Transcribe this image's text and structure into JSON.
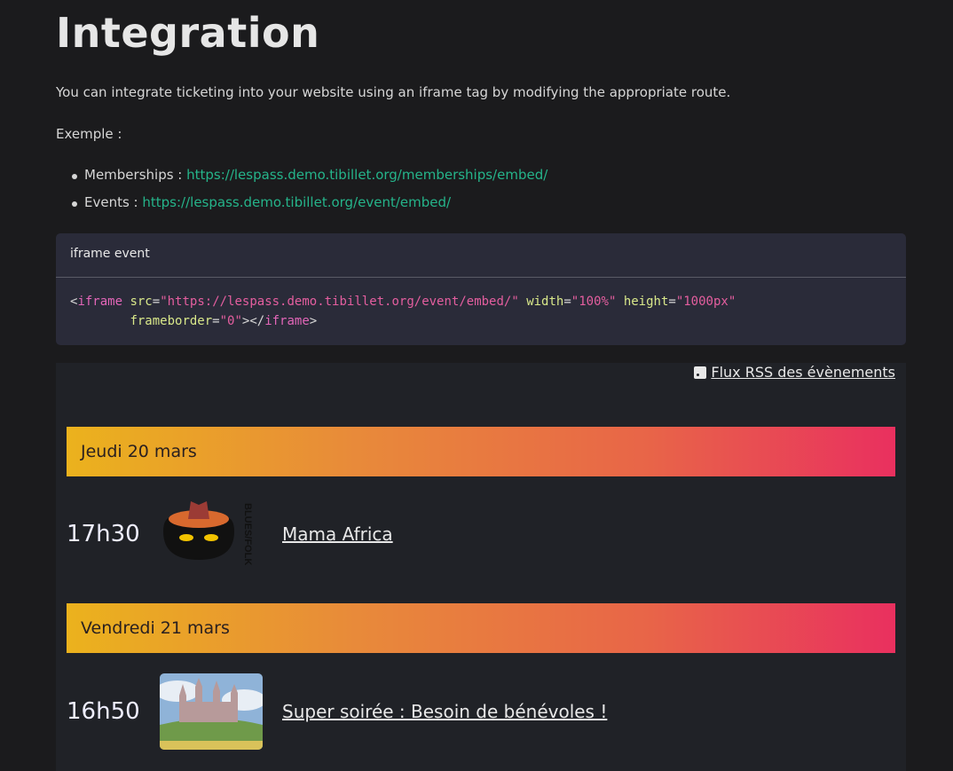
{
  "title": "Integration",
  "intro": "You can integrate ticketing into your website using an iframe tag by modifying the appropriate route.",
  "example_label": "Exemple :",
  "links": [
    {
      "label": "Memberships : ",
      "url": "https://lespass.demo.tibillet.org/memberships/embed/"
    },
    {
      "label": "Events : ",
      "url": "https://lespass.demo.tibillet.org/event/embed/"
    }
  ],
  "code_card": {
    "title": "iframe event",
    "tag": "iframe",
    "src_attr": "src",
    "src": "\"https://lespass.demo.tibillet.org/event/embed/\"",
    "width_attr": "width",
    "width": "\"100%\"",
    "height_attr": "height",
    "height": "\"1000px\"",
    "fb_attr": "frameborder",
    "fb": "\"0\""
  },
  "embed": {
    "rss_label": "Flux RSS des évènements",
    "days": [
      {
        "label": "Jeudi 20 mars",
        "events": [
          {
            "time": "17h30",
            "title": "Mama Africa",
            "image_text": "BLUES/FOLK"
          }
        ]
      },
      {
        "label": "Vendredi 21 mars",
        "events": [
          {
            "time": "16h50",
            "title": "Super soirée : Besoin de bénévoles !"
          }
        ]
      }
    ]
  },
  "colors": {
    "link": "#25b48a",
    "gradient_start": "#ebb21d",
    "gradient_end": "#e9305f"
  }
}
